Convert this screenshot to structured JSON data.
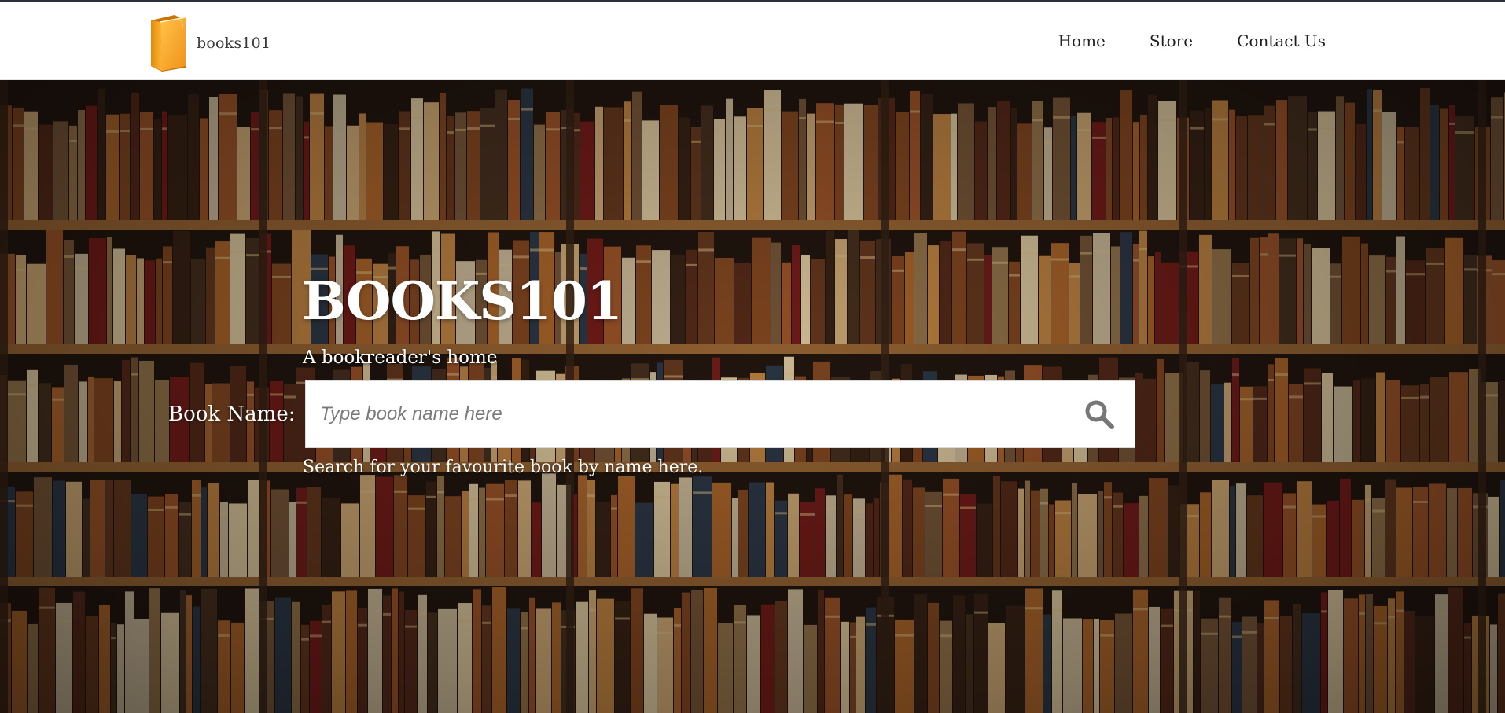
{
  "brand": {
    "name": "books101",
    "logo_icon": "book-icon",
    "logo_color": "#f2a51c"
  },
  "nav": {
    "items": [
      {
        "label": "Home"
      },
      {
        "label": "Store"
      },
      {
        "label": "Contact Us"
      }
    ]
  },
  "hero": {
    "background_image": "bookshelf-photo",
    "title": "BOOKS101",
    "subtitle": "A bookreader's home"
  },
  "search": {
    "label": "Book Name:",
    "placeholder": "Type book name here",
    "button_icon": "search-icon",
    "help_text": "Search for your favourite book by name here."
  },
  "colors": {
    "text_on_hero": "#ffffff",
    "nav_text": "#202020",
    "top_border": "#2a2f3a",
    "search_icon": "#777777"
  }
}
